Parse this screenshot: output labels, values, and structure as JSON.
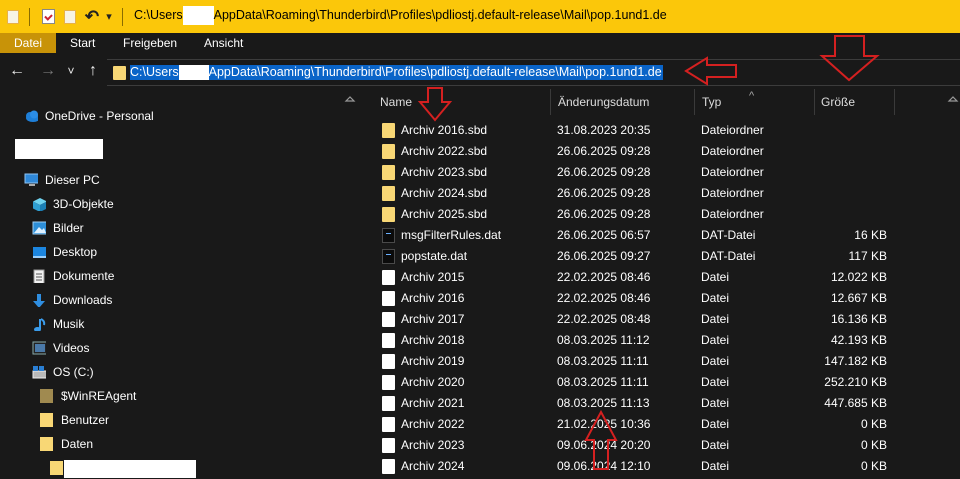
{
  "titlebar": {
    "path_start": "C:\\Users",
    "path_end": "AppData\\Roaming\\Thunderbird\\Profiles\\pdliostj.default-release\\Mail\\pop.1und1.de",
    "undo_glyph": "↶",
    "dropdown_glyph": "▾"
  },
  "ribbon": {
    "tabs": [
      "Datei",
      "Start",
      "Freigeben",
      "Ansicht"
    ]
  },
  "nav": {
    "back": "←",
    "forward": "→",
    "recent": "˅",
    "up": "↑"
  },
  "address": {
    "path_start": "C:\\Users",
    "path_end": "AppData\\Roaming\\Thunderbird\\Profiles\\pdliostj.default-release\\Mail\\pop.1und1.de"
  },
  "sidebar": {
    "onedrive": "OneDrive - Personal",
    "this_pc": "Dieser PC",
    "items": [
      "3D-Objekte",
      "Bilder",
      "Desktop",
      "Dokumente",
      "Downloads",
      "Musik",
      "Videos",
      "OS (C:)"
    ],
    "drive_items": [
      "$WinREAgent",
      "Benutzer",
      "Daten"
    ]
  },
  "columns": {
    "name": "Name",
    "date": "Änderungsdatum",
    "type": "Typ",
    "size": "Größe",
    "sort_glyph": "^"
  },
  "files": [
    {
      "icon": "folder-icon",
      "name": "Archiv 2016.sbd",
      "date": "31.08.2023 20:35",
      "type": "Dateiordner",
      "size": ""
    },
    {
      "icon": "folder-icon",
      "name": "Archiv 2022.sbd",
      "date": "26.06.2025 09:28",
      "type": "Dateiordner",
      "size": ""
    },
    {
      "icon": "folder-icon",
      "name": "Archiv 2023.sbd",
      "date": "26.06.2025 09:28",
      "type": "Dateiordner",
      "size": ""
    },
    {
      "icon": "folder-icon",
      "name": "Archiv 2024.sbd",
      "date": "26.06.2025 09:28",
      "type": "Dateiordner",
      "size": ""
    },
    {
      "icon": "folder-icon",
      "name": "Archiv 2025.sbd",
      "date": "26.06.2025 09:28",
      "type": "Dateiordner",
      "size": ""
    },
    {
      "icon": "dat-file-icon",
      "name": "msgFilterRules.dat",
      "date": "26.06.2025 06:57",
      "type": "DAT-Datei",
      "size": "16 KB"
    },
    {
      "icon": "dat-file-icon",
      "name": "popstate.dat",
      "date": "26.06.2025 09:27",
      "type": "DAT-Datei",
      "size": "117 KB"
    },
    {
      "icon": "file-icon",
      "name": "Archiv 2015",
      "date": "22.02.2025 08:46",
      "type": "Datei",
      "size": "12.022 KB"
    },
    {
      "icon": "file-icon",
      "name": "Archiv 2016",
      "date": "22.02.2025 08:46",
      "type": "Datei",
      "size": "12.667 KB"
    },
    {
      "icon": "file-icon",
      "name": "Archiv 2017",
      "date": "22.02.2025 08:48",
      "type": "Datei",
      "size": "16.136 KB"
    },
    {
      "icon": "file-icon",
      "name": "Archiv 2018",
      "date": "08.03.2025 11:12",
      "type": "Datei",
      "size": "42.193 KB"
    },
    {
      "icon": "file-icon",
      "name": "Archiv 2019",
      "date": "08.03.2025 11:11",
      "type": "Datei",
      "size": "147.182 KB"
    },
    {
      "icon": "file-icon",
      "name": "Archiv 2020",
      "date": "08.03.2025 11:11",
      "type": "Datei",
      "size": "252.210 KB"
    },
    {
      "icon": "file-icon",
      "name": "Archiv 2021",
      "date": "08.03.2025 11:13",
      "type": "Datei",
      "size": "447.685 KB"
    },
    {
      "icon": "file-icon",
      "name": "Archiv 2022",
      "date": "21.02.2025 10:36",
      "type": "Datei",
      "size": "0 KB"
    },
    {
      "icon": "file-icon",
      "name": "Archiv 2023",
      "date": "09.06.2024 20:20",
      "type": "Datei",
      "size": "0 KB"
    },
    {
      "icon": "file-icon",
      "name": "Archiv 2024",
      "date": "09.06.2024 12:10",
      "type": "Datei",
      "size": "0 KB"
    }
  ],
  "colors": {
    "title_bar": "#fbc70a",
    "selection": "#0a64c8",
    "annotation_arrow": "#d42020",
    "background": "#191919"
  }
}
